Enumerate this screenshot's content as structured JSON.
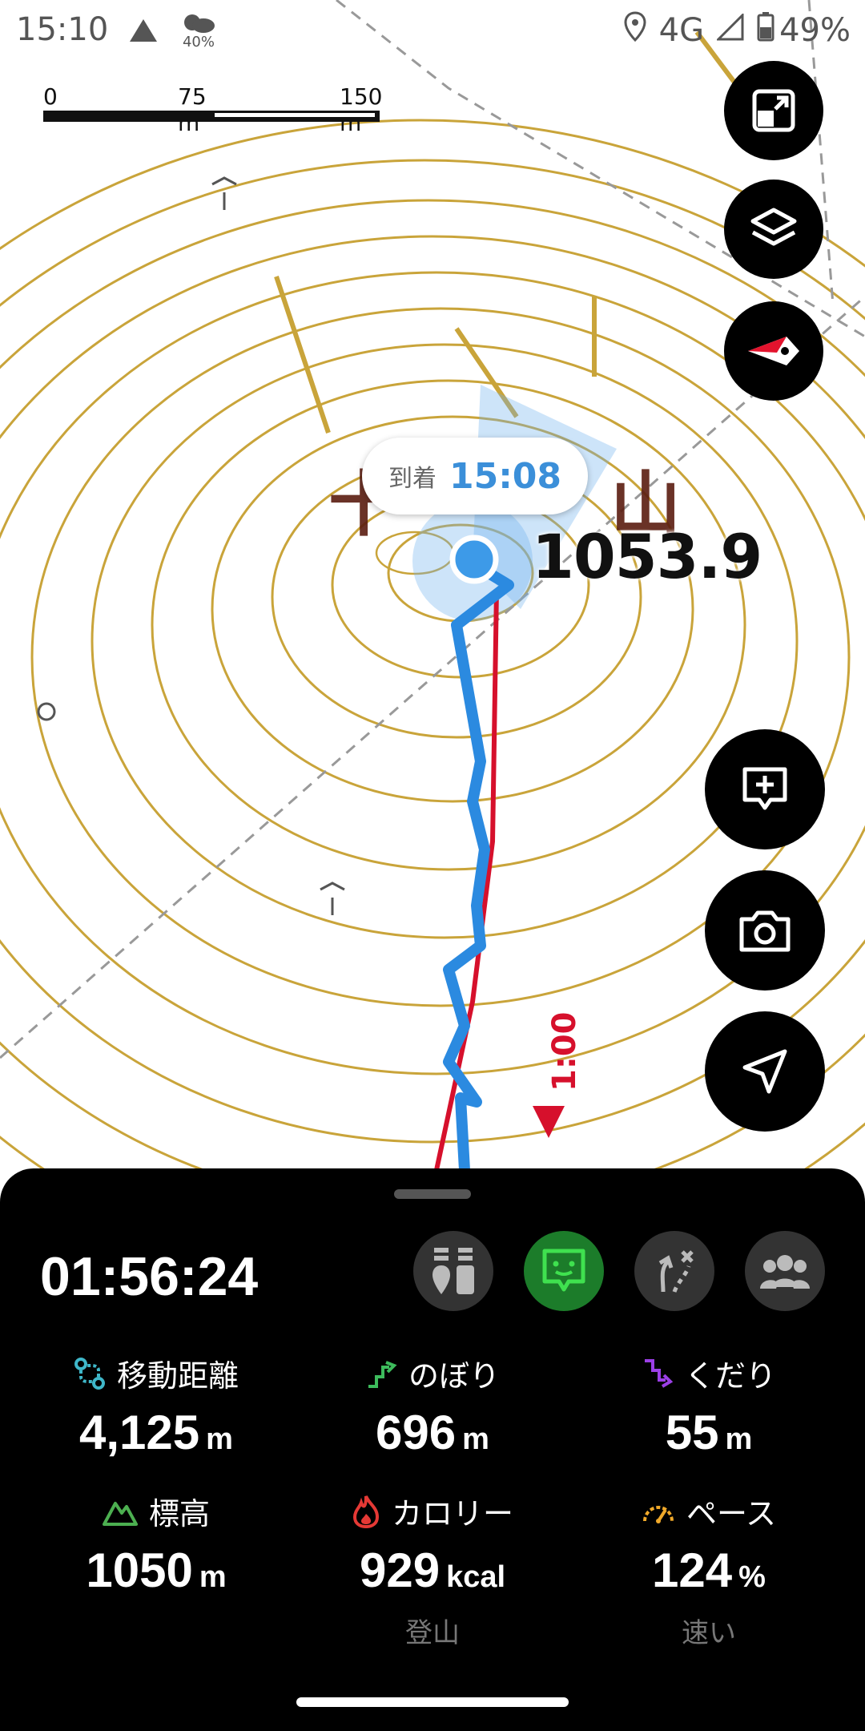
{
  "status_bar": {
    "time": "15:10",
    "weather_percent": "40%",
    "network": "4G",
    "battery": "49%"
  },
  "scale": {
    "labels": [
      "0",
      "75 m",
      "150 m"
    ]
  },
  "map": {
    "arrival_label": "到着",
    "arrival_time": "15:08",
    "peak_elevation": "1053.9",
    "route_marker": "1:00",
    "colors": {
      "contour": "#c9a43a",
      "track": "#2b8ae0",
      "route": "#d6102c"
    }
  },
  "fabs": [
    "expand-icon",
    "layers-icon",
    "compass-icon",
    "add-memo-icon",
    "camera-icon",
    "navigate-icon"
  ],
  "panel": {
    "elapsed_time": "01:56:24",
    "mode_buttons": [
      "equipment-icon",
      "map-face-icon",
      "route-icon",
      "group-icon"
    ],
    "stats": [
      {
        "label": "移動距離",
        "value": "4,125",
        "unit": "m",
        "sub": ""
      },
      {
        "label": "のぼり",
        "value": "696",
        "unit": "m",
        "sub": ""
      },
      {
        "label": "くだり",
        "value": "55",
        "unit": "m",
        "sub": ""
      },
      {
        "label": "標高",
        "value": "1050",
        "unit": "m",
        "sub": ""
      },
      {
        "label": "カロリー",
        "value": "929",
        "unit": "kcal",
        "sub": "登山"
      },
      {
        "label": "ペース",
        "value": "124",
        "unit": "%",
        "sub": "速い"
      }
    ]
  }
}
